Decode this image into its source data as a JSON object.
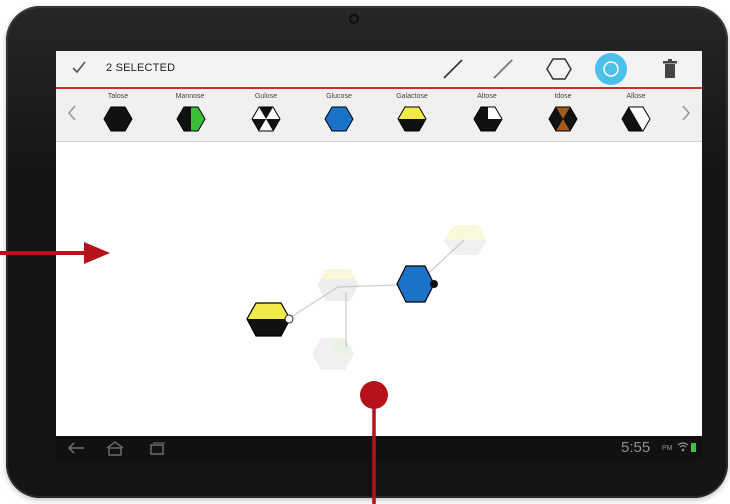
{
  "action_bar": {
    "selection_label": "2 SELECTED",
    "tools": [
      {
        "name": "line",
        "icon": "line-icon"
      },
      {
        "name": "dashed line",
        "icon": "dashed-line-icon"
      },
      {
        "name": "hexagon",
        "icon": "hexagon-icon"
      },
      {
        "name": "circle",
        "icon": "circle-icon",
        "active": true
      },
      {
        "name": "delete",
        "icon": "trash-icon"
      }
    ],
    "accent_color": "#c9302c",
    "active_tool_color": "#2bb6e8"
  },
  "palette": {
    "items": [
      {
        "label": "Talose",
        "pattern": "solid-black"
      },
      {
        "label": "Mannose",
        "pattern": "green-black-half"
      },
      {
        "label": "Gulose",
        "pattern": "black-white-sixths"
      },
      {
        "label": "Glucose",
        "pattern": "solid-blue"
      },
      {
        "label": "Galactose",
        "pattern": "yellow-black"
      },
      {
        "label": "Altose",
        "pattern": "black-white-quarter"
      },
      {
        "label": "Idose",
        "pattern": "brown-black-triangles"
      },
      {
        "label": "Allose",
        "pattern": "black-white-diagonal"
      }
    ],
    "left_arrow": "chevron-left-icon",
    "right_arrow": "chevron-right-icon"
  },
  "canvas": {
    "nodes": [
      {
        "name": "galactose-node",
        "fill": "#f0ea4a",
        "selected": true
      },
      {
        "name": "glucose-node",
        "fill": "#1a73c9",
        "selected": true
      },
      {
        "name": "faded-node-center",
        "selected": false
      },
      {
        "name": "faded-node-top-right",
        "selected": false
      },
      {
        "name": "faded-node-bottom",
        "selected": false
      }
    ]
  },
  "status_bar": {
    "time": "5:55",
    "ampm": "PM",
    "icons": [
      "back-icon",
      "home-icon",
      "recent-apps-icon",
      "wifi-icon",
      "battery-icon"
    ]
  },
  "colors": {
    "annotation_red": "#b5121b",
    "glucose_blue": "#1a73c9",
    "galactose_yellow": "#f0ea4a",
    "mannose_green": "#3bbf3b",
    "idose_brown": "#a05a1e"
  }
}
